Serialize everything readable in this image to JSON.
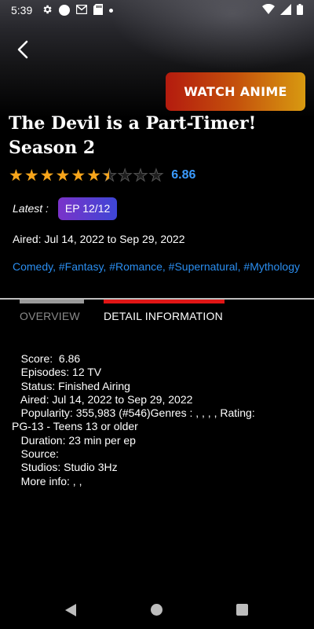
{
  "status_bar": {
    "time": "5:39",
    "icons_left": [
      "settings-icon",
      "circle-icon",
      "gmail-icon",
      "sd-card-icon",
      "dot-icon"
    ],
    "icons_right": [
      "wifi-icon",
      "signal-icon",
      "battery-icon"
    ]
  },
  "header": {
    "back_icon": "back-chevron-icon",
    "watch_label": "WATCH ANIME"
  },
  "anime": {
    "title": "The Devil is a Part-Timer! Season 2",
    "rating": 6.86,
    "rating_text": "6.86",
    "stars_max": 10,
    "latest_label": "Latest :",
    "latest_episode": "EP 12/12",
    "aired": "Aired: Jul 14, 2022 to Sep 29, 2022",
    "genres": "Comedy, #Fantasy, #Romance, #Supernatural, #Mythology"
  },
  "tabs": [
    {
      "label": "OVERVIEW",
      "active": false
    },
    {
      "label": "DETAIL INFORMATION",
      "active": true
    }
  ],
  "details": {
    "lines": [
      "   Score:  6.86",
      "   Episodes: 12 TV",
      "   Status: Finished Airing",
      "   Aired: Jul 14, 2022 to Sep 29, 2022",
      "   Popularity: 355,983 (#546)Genres : , , , , Rating:",
      "PG-13 - Teens 13 or older",
      "   Duration: 23 min per ep",
      "   Source:",
      "   Studios: Studio 3Hz",
      "   More info: , ,"
    ]
  },
  "colors": {
    "accent_blue": "#3a9bff",
    "star": "#f7a51b",
    "tab_active": "#e01616",
    "watch_start": "#b41b0e",
    "watch_end": "#d89a10"
  },
  "nav": [
    "nav-back-icon",
    "nav-home-icon",
    "nav-recents-icon"
  ]
}
